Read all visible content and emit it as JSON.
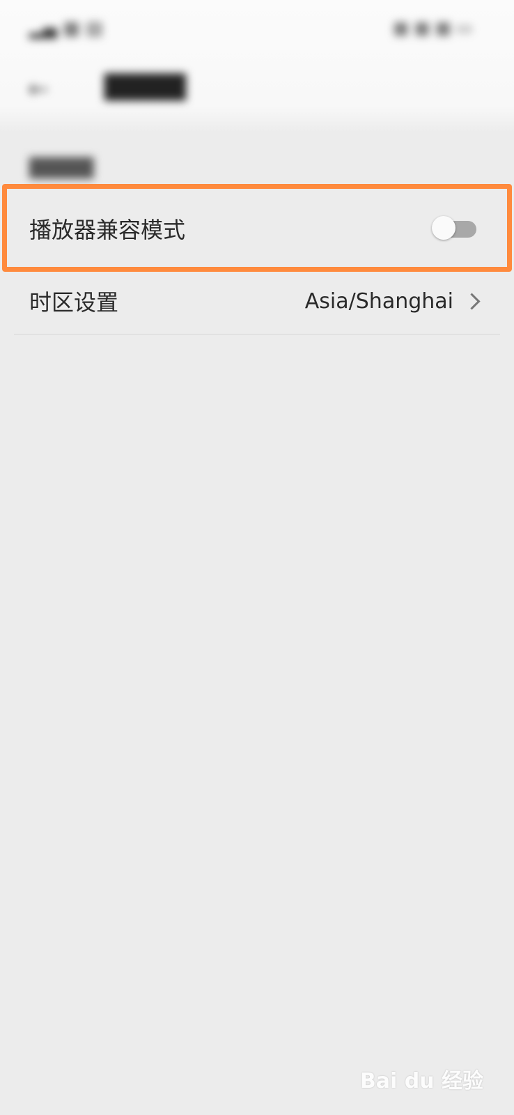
{
  "settings": {
    "compat_mode_label": "播放器兼容模式",
    "compat_mode_enabled": false,
    "timezone_label": "时区设置",
    "timezone_value": "Asia/Shanghai"
  },
  "colors": {
    "highlight": "#ff8a3d",
    "background": "#ececec"
  },
  "watermark": {
    "text": "Bai du 经验"
  }
}
